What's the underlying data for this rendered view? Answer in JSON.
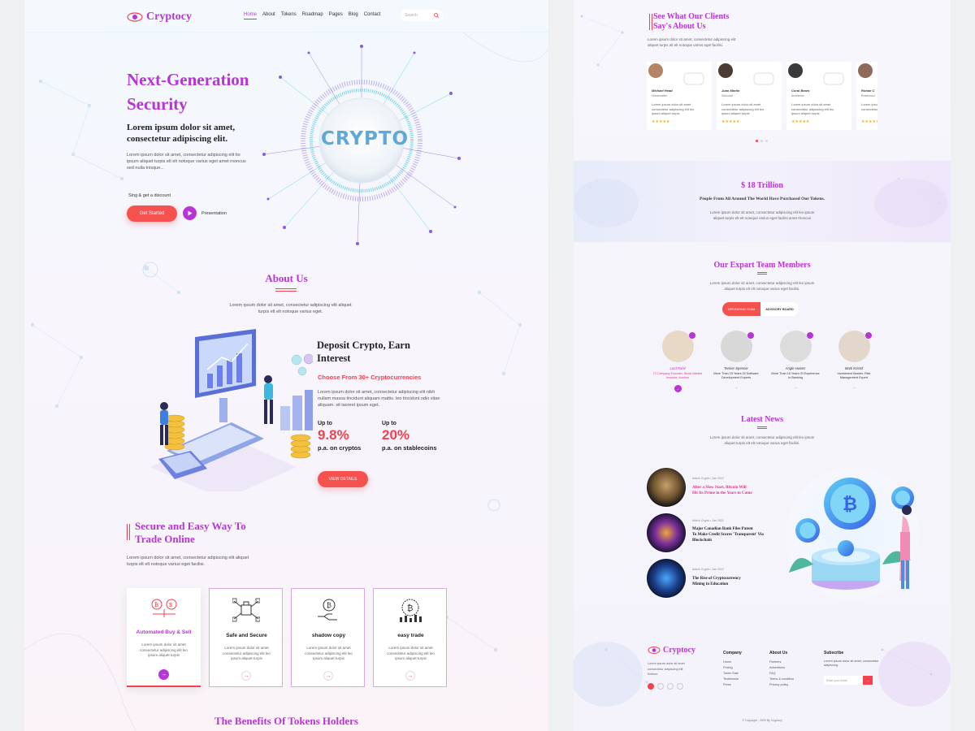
{
  "brand": {
    "name": "Cryptocy"
  },
  "nav": {
    "items": [
      "Home",
      "About",
      "Tokens",
      "Roadmap",
      "Pages",
      "Blog",
      "Contact"
    ],
    "search_placeholder": "Search"
  },
  "hero": {
    "title_line1": "Next-Generation",
    "title_line2": "Security",
    "subtitle_line1": "Lorem ipsum dolor sit amet,",
    "subtitle_line2": "consectetur adipiscing elit.",
    "body": "Lorem ipsum dolor sit amet, consectetur adipiscing elit tio ipsum aliquet turpis elt elt notoque varius eget amet rnoncus sed nulla tnisque...",
    "signup": "Sing & get a discount",
    "cta": "Get Started",
    "presentation": "Presentation",
    "orb_text": "CRYPTO"
  },
  "about": {
    "title": "About Us",
    "text": "Lorem ipsum dolor sit amet, consectetur adipiscing elit aliquet turpis elt elt notoque varius eget.",
    "deposit_title_line1": "Deposit Crypto, Earn",
    "deposit_title_line2": "Interest",
    "choose": "Choose From 30+ Cryptocurrencies",
    "deposit_body": "Lorem ipsum dolor sit amet, consectetur adipiscing elit nibh nullam massa tincidunt aliquam mattis. leo tincidunt odio vitae aliquam. sit laoreet ipsum eget.",
    "stat1_upto": "Up to",
    "stat1_value": "9.8%",
    "stat1_label": "p.a. on cryptos",
    "stat2_upto": "Up to",
    "stat2_value": "20%",
    "stat2_label": "p.a. on stablecoins",
    "view_details": "VIEW DETAILS"
  },
  "secure": {
    "title_line1": "Secure and Easy Way To",
    "title_line2": "Trade Online",
    "text": "Lorem ipsum dolor sit amet, consectetur adipiscing elit aliquet turpis elt elt notoque varius eget facilisi.",
    "cards": [
      {
        "title": "Automated Buy & Sell",
        "text": "Lorem ipsum dolor sit amet consectetur adipiscing elit leo ipsum aliquet turpis"
      },
      {
        "title": "Safe and Secure",
        "text": "Lorem ipsum dolor sit amet consectetur adipiscing elit leo ipsum aliquet turpis"
      },
      {
        "title": "shadow copy",
        "text": "Lorem ipsum dolor sit amet consectetur adipiscing elit leo ipsum aliquet turpis"
      },
      {
        "title": "easy trade",
        "text": "Lorem ipsum dolor sit amet consectetur adipiscing elit leo ipsum aliquet turpis"
      }
    ]
  },
  "benefits": {
    "title": "The Benefits Of Tokens Holders"
  },
  "clients": {
    "title_line1": "See What Our Clients",
    "title_line2": "Say's About Us",
    "text": "Lorem ipsum dolor sit amet, consectetur adipiscing elit aliquet turpis elt elt notoque varius eget facilisi.",
    "testimonials": [
      {
        "name": "Michael Head",
        "role": "Homecrafter",
        "text": "Lorem ipsum dolor sit amet consectetur adipiscing elit leo ipsum aliquet turpis",
        "stars": "★★★★★"
      },
      {
        "name": "Juan Martin",
        "role": "Sericoad",
        "text": "Lorem ipsum dolor sit amet consectetur adipiscing elit leo ipsum aliquet turpis",
        "stars": "★★★★★"
      },
      {
        "name": "Coral Bears",
        "role": "Architecte",
        "text": "Lorem ipsum dolor sit amet consectetur adipiscing elit leo ipsum aliquet turpis",
        "stars": "★★★★★"
      },
      {
        "name": "Rohan C",
        "role": "Rosewood",
        "text": "Lorem ipsum dolor sit amet consectetur adipiscing",
        "stars": "★★★★★"
      }
    ]
  },
  "trillion": {
    "value": "$ 18 Trillion",
    "subtitle": "People From All Around The World Have Purchased Our Tokens.",
    "text": "Lorem ipsum dolor sit amet, consectetur adipiscing elit leo ipsum aliquet turpis elt elt notoque varius eget facilisi amet rhoncus"
  },
  "team": {
    "title": "Our Expart Team Members",
    "text": "Lorem ipsum dolor sit amet, consectetur adipiscing elit leo ipsum aliquet turpis elt elt notoque varius eget facilisi.",
    "tab_active": "OPERATING TEAM",
    "tab_other": "ADVISORY BOARD",
    "members": [
      {
        "name": "Lord Rahil",
        "role": "IT Company Founder, Stock Market Investor, Auction",
        "color": "#b735d6"
      },
      {
        "name": "Tenner Spencer",
        "role": "More Than 15 Years Of Software Development Experts",
        "color": "#333"
      },
      {
        "name": "Angle Hunter",
        "role": "More Than 15 Years Of Experience In Banking",
        "color": "#333"
      },
      {
        "name": "Mark Kristof",
        "role": "Investment Banker, Risk Management Expert",
        "color": "#333"
      }
    ]
  },
  "news": {
    "title": "Latest News",
    "text": "Lorem ipsum dolor sit amet, consectetur adipiscing elit leo ipsum aliquet turpis elt elt notoque varius eget facilisi.",
    "items": [
      {
        "meta": "Admin Crypto  •  Jan 2022",
        "title_line1": "After a Slow Start, Bitcoin Will",
        "title_line2": "Hit Its Prime in the Years to Come",
        "highlight": true
      },
      {
        "meta": "Admin Crypto  •  Jan 2022",
        "title_line1": "Major Canadian Bank Files Patent",
        "title_line2": "To Make Credit Scores 'Transparent' Via Blockchain",
        "highlight": false
      },
      {
        "meta": "Admin Crypto  •  Jan 2022",
        "title_line1": "The Rise of Cryptocurrency",
        "title_line2": "Mining in Education",
        "highlight": false
      }
    ]
  },
  "footer": {
    "brand": "Cryptocy",
    "about_text": "Lorem ipsum dolor sit amet consectetur adipiscing elit finibum.",
    "company_title": "Company",
    "company_links": [
      "Home",
      "Pricing",
      "Token Sale",
      "Testimonial",
      "Press"
    ],
    "about_title": "About Us",
    "about_links": [
      "Partners",
      "Advertisers",
      "FAQ",
      "Terms & condition",
      "Privacy policy"
    ],
    "subscribe_title": "Subscribe",
    "subscribe_text": "Lorem ipsum dolor sit amet, consectetur adipiscing.",
    "email_placeholder": "Enter your email",
    "copyright": "© Copyright - 2020 By Cryptocy"
  },
  "colors": {
    "accent_purple": "#b735d6",
    "accent_red": "#f4414e",
    "cyan": "#2ec4e6"
  }
}
